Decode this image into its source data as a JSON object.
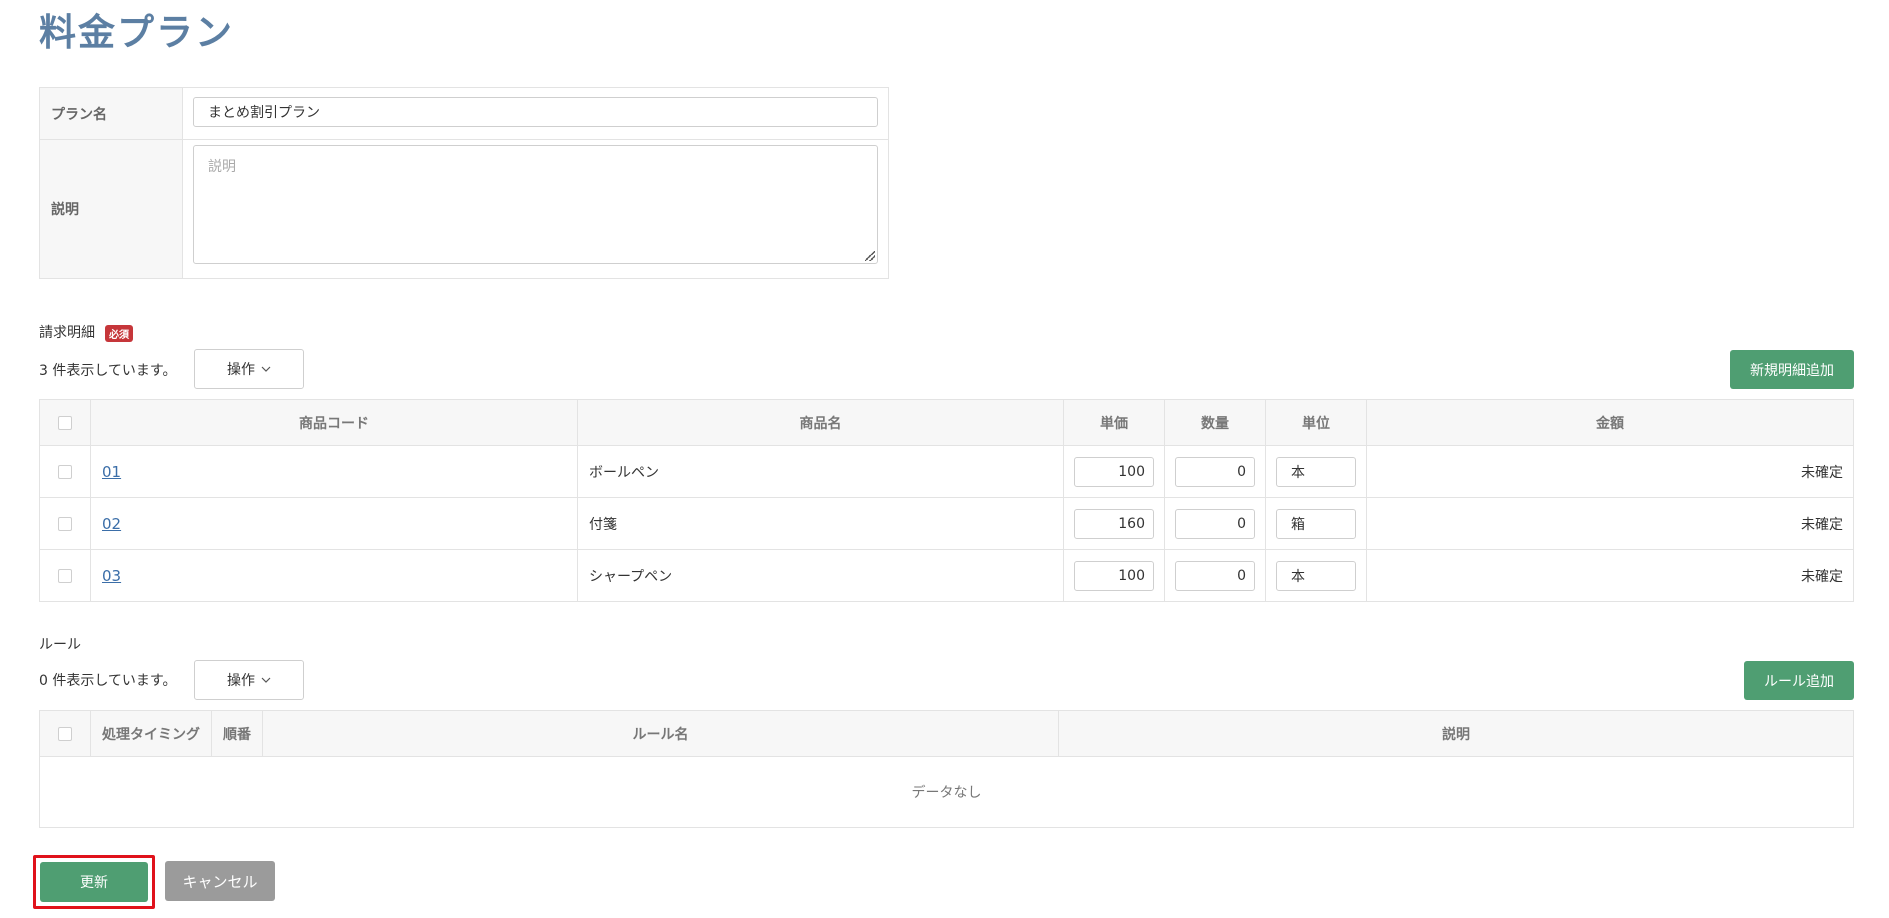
{
  "page": {
    "title": "料金プラン"
  },
  "form": {
    "plan_name_label": "プラン名",
    "plan_name_value": "まとめ割引プラン",
    "description_label": "説明",
    "description_placeholder": "説明"
  },
  "billing": {
    "section_label": "請求明細",
    "required_badge": "必須",
    "count_text": "3 件表示しています。",
    "operation_label": "操作",
    "add_button": "新規明細追加",
    "headers": [
      "商品コード",
      "商品名",
      "単価",
      "数量",
      "単位",
      "金額"
    ],
    "rows": [
      {
        "code": "01",
        "name": "ボールペン",
        "price": "100",
        "qty": "0",
        "unit": "本",
        "amount": "未確定"
      },
      {
        "code": "02",
        "name": "付箋",
        "price": "160",
        "qty": "0",
        "unit": "箱",
        "amount": "未確定"
      },
      {
        "code": "03",
        "name": "シャープペン",
        "price": "100",
        "qty": "0",
        "unit": "本",
        "amount": "未確定"
      }
    ]
  },
  "rules": {
    "section_label": "ルール",
    "count_text": "0 件表示しています。",
    "operation_label": "操作",
    "add_button": "ルール追加",
    "headers": [
      "処理タイミング",
      "順番",
      "ルール名",
      "説明"
    ],
    "empty_text": "データなし"
  },
  "footer": {
    "update_button": "更新",
    "cancel_button": "キャンセル"
  },
  "colors": {
    "title": "#5c7fa3",
    "primary_green": "#4f9e72",
    "highlight_red": "#e0121b",
    "cancel_gray": "#9b9b9b"
  }
}
